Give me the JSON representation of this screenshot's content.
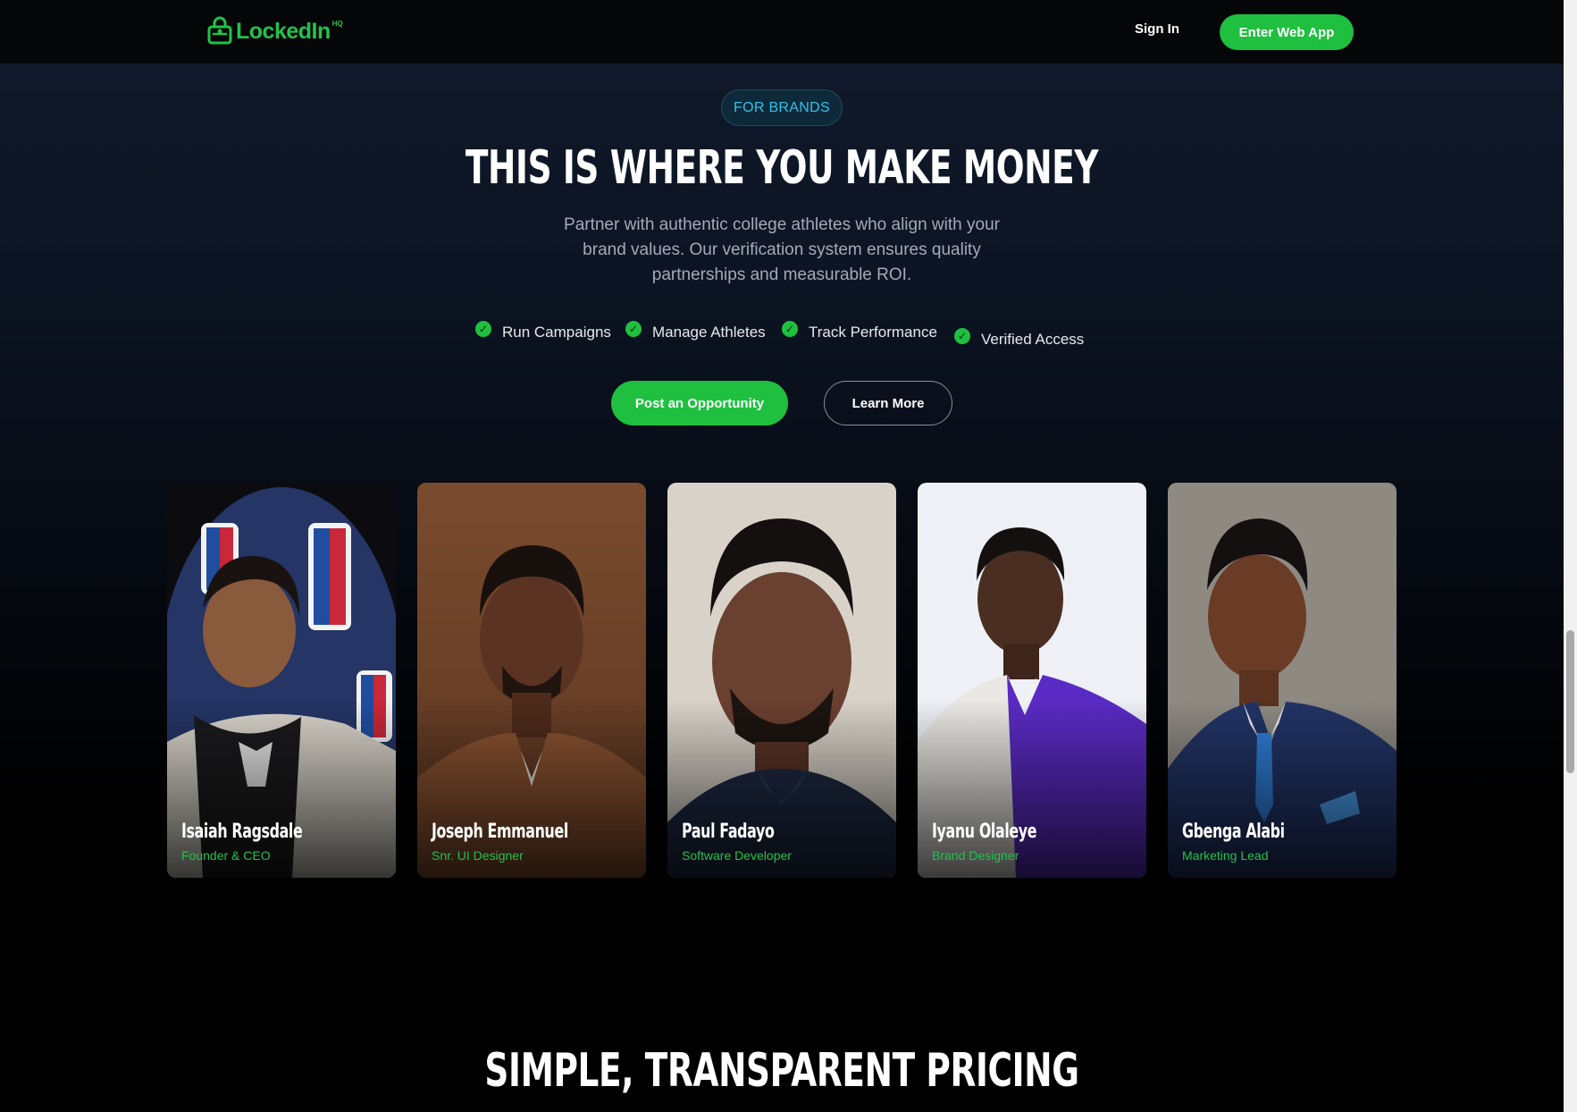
{
  "header": {
    "brand": "LockedIn",
    "brand_sup": "HQ",
    "signin_label": "Sign In",
    "enter_label": "Enter Web App"
  },
  "hero": {
    "badge": "FOR BRANDS",
    "title": "THIS IS WHERE YOU MAKE MONEY",
    "subtitle": "Partner with authentic college athletes who align with your brand values. Our verification system ensures quality partnerships and measurable ROI.",
    "features": [
      {
        "label": "Run Campaigns"
      },
      {
        "label": "Manage Athletes"
      },
      {
        "label": "Track Performance"
      },
      {
        "label": "Verified Access"
      }
    ],
    "primary_cta": "Post an Opportunity",
    "secondary_cta": "Learn More"
  },
  "team": [
    {
      "name": "Isaiah Ragsdale",
      "role": "Founder & CEO"
    },
    {
      "name": "Joseph Emmanuel",
      "role": "Snr. UI Designer"
    },
    {
      "name": "Paul Fadayo",
      "role": "Software Developer"
    },
    {
      "name": "Iyanu Olaleye",
      "role": "Brand Designer"
    },
    {
      "name": "Gbenga Alabi",
      "role": "Marketing Lead"
    }
  ],
  "pricing": {
    "title": "SIMPLE, TRANSPARENT PRICING"
  },
  "colors": {
    "accent": "#1fbf3f",
    "badge_text": "#35c0e8",
    "background": "#0d1524"
  }
}
